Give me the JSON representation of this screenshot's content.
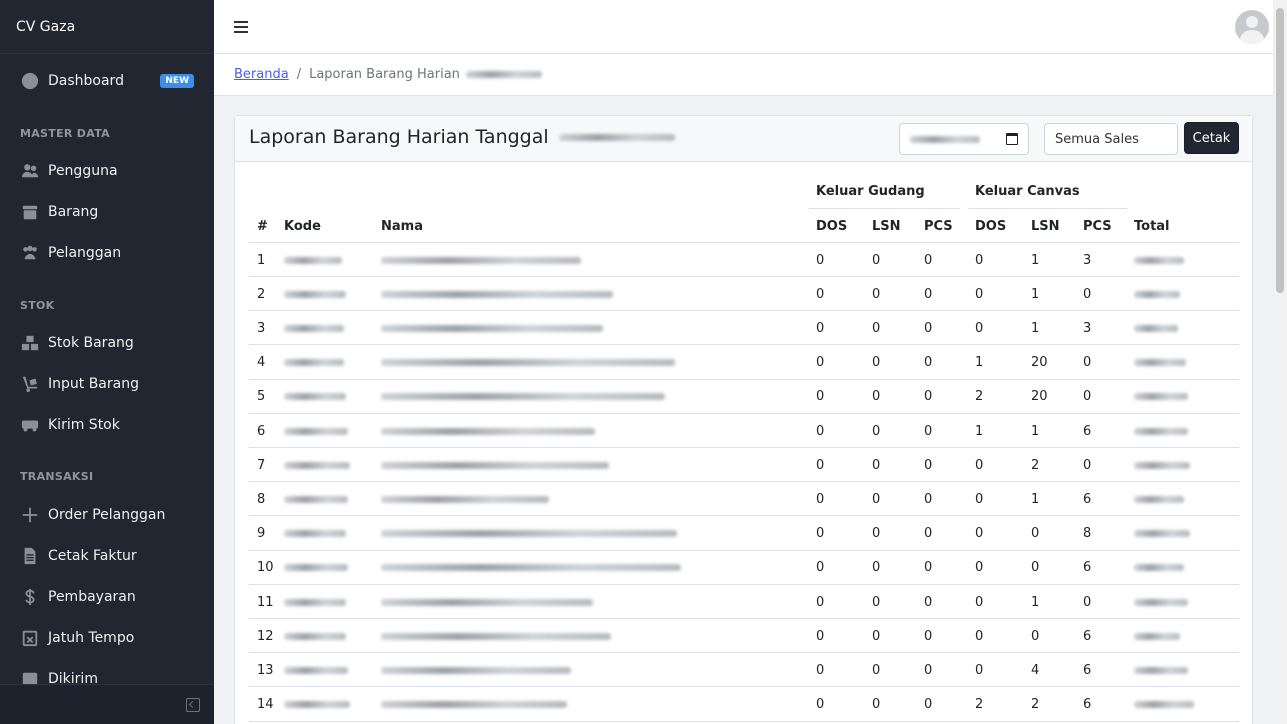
{
  "brand": "CV Gaza",
  "sidebar": {
    "dashboard": {
      "label": "Dashboard",
      "badge": "NEW",
      "icon": "dashboard-icon"
    },
    "sections": [
      {
        "title": "MASTER DATA",
        "items": [
          {
            "label": "Pengguna",
            "icon": "users-icon"
          },
          {
            "label": "Barang",
            "icon": "box-icon"
          },
          {
            "label": "Pelanggan",
            "icon": "customers-icon"
          }
        ]
      },
      {
        "title": "STOK",
        "items": [
          {
            "label": "Stok Barang",
            "icon": "boxes-icon"
          },
          {
            "label": "Input Barang",
            "icon": "dolly-icon"
          },
          {
            "label": "Kirim Stok",
            "icon": "truck-icon"
          }
        ]
      },
      {
        "title": "TRANSAKSI",
        "items": [
          {
            "label": "Order Pelanggan",
            "icon": "plus-icon"
          },
          {
            "label": "Cetak Faktur",
            "icon": "invoice-icon"
          },
          {
            "label": "Pembayaran",
            "icon": "dollar-icon"
          },
          {
            "label": "Jatuh Tempo",
            "icon": "calendar-x-icon"
          },
          {
            "label": "Dikirim",
            "icon": "inbox-icon"
          }
        ]
      }
    ]
  },
  "breadcrumb": {
    "home": "Beranda",
    "current": "Laporan Barang Harian"
  },
  "card": {
    "title": "Laporan Barang Harian Tanggal",
    "sales_select": "Semua Sales",
    "print_button": "Cetak"
  },
  "table": {
    "group_headers": {
      "gudang": "Keluar Gudang",
      "canvas": "Keluar Canvas"
    },
    "headers": [
      "#",
      "Kode",
      "Nama",
      "DOS",
      "LSN",
      "PCS",
      "DOS",
      "LSN",
      "PCS",
      "Total"
    ],
    "rows": [
      {
        "no": "1",
        "g_dos": "0",
        "g_lsn": "0",
        "g_pcs": "0",
        "c_dos": "0",
        "c_lsn": "1",
        "c_pcs": "3"
      },
      {
        "no": "2",
        "g_dos": "0",
        "g_lsn": "0",
        "g_pcs": "0",
        "c_dos": "0",
        "c_lsn": "1",
        "c_pcs": "0"
      },
      {
        "no": "3",
        "g_dos": "0",
        "g_lsn": "0",
        "g_pcs": "0",
        "c_dos": "0",
        "c_lsn": "1",
        "c_pcs": "3"
      },
      {
        "no": "4",
        "g_dos": "0",
        "g_lsn": "0",
        "g_pcs": "0",
        "c_dos": "1",
        "c_lsn": "20",
        "c_pcs": "0"
      },
      {
        "no": "5",
        "g_dos": "0",
        "g_lsn": "0",
        "g_pcs": "0",
        "c_dos": "2",
        "c_lsn": "20",
        "c_pcs": "0"
      },
      {
        "no": "6",
        "g_dos": "0",
        "g_lsn": "0",
        "g_pcs": "0",
        "c_dos": "1",
        "c_lsn": "1",
        "c_pcs": "6"
      },
      {
        "no": "7",
        "g_dos": "0",
        "g_lsn": "0",
        "g_pcs": "0",
        "c_dos": "0",
        "c_lsn": "2",
        "c_pcs": "0"
      },
      {
        "no": "8",
        "g_dos": "0",
        "g_lsn": "0",
        "g_pcs": "0",
        "c_dos": "0",
        "c_lsn": "1",
        "c_pcs": "6"
      },
      {
        "no": "9",
        "g_dos": "0",
        "g_lsn": "0",
        "g_pcs": "0",
        "c_dos": "0",
        "c_lsn": "0",
        "c_pcs": "8"
      },
      {
        "no": "10",
        "g_dos": "0",
        "g_lsn": "0",
        "g_pcs": "0",
        "c_dos": "0",
        "c_lsn": "0",
        "c_pcs": "6"
      },
      {
        "no": "11",
        "g_dos": "0",
        "g_lsn": "0",
        "g_pcs": "0",
        "c_dos": "0",
        "c_lsn": "1",
        "c_pcs": "0"
      },
      {
        "no": "12",
        "g_dos": "0",
        "g_lsn": "0",
        "g_pcs": "0",
        "c_dos": "0",
        "c_lsn": "0",
        "c_pcs": "6"
      },
      {
        "no": "13",
        "g_dos": "0",
        "g_lsn": "0",
        "g_pcs": "0",
        "c_dos": "0",
        "c_lsn": "4",
        "c_pcs": "6"
      },
      {
        "no": "14",
        "g_dos": "0",
        "g_lsn": "0",
        "g_pcs": "0",
        "c_dos": "2",
        "c_lsn": "2",
        "c_pcs": "6"
      }
    ]
  },
  "colors": {
    "sidebar_bg": "#212631",
    "badge": "#3b8fe8",
    "link": "#4a5ee6",
    "button_dark": "#212631"
  }
}
